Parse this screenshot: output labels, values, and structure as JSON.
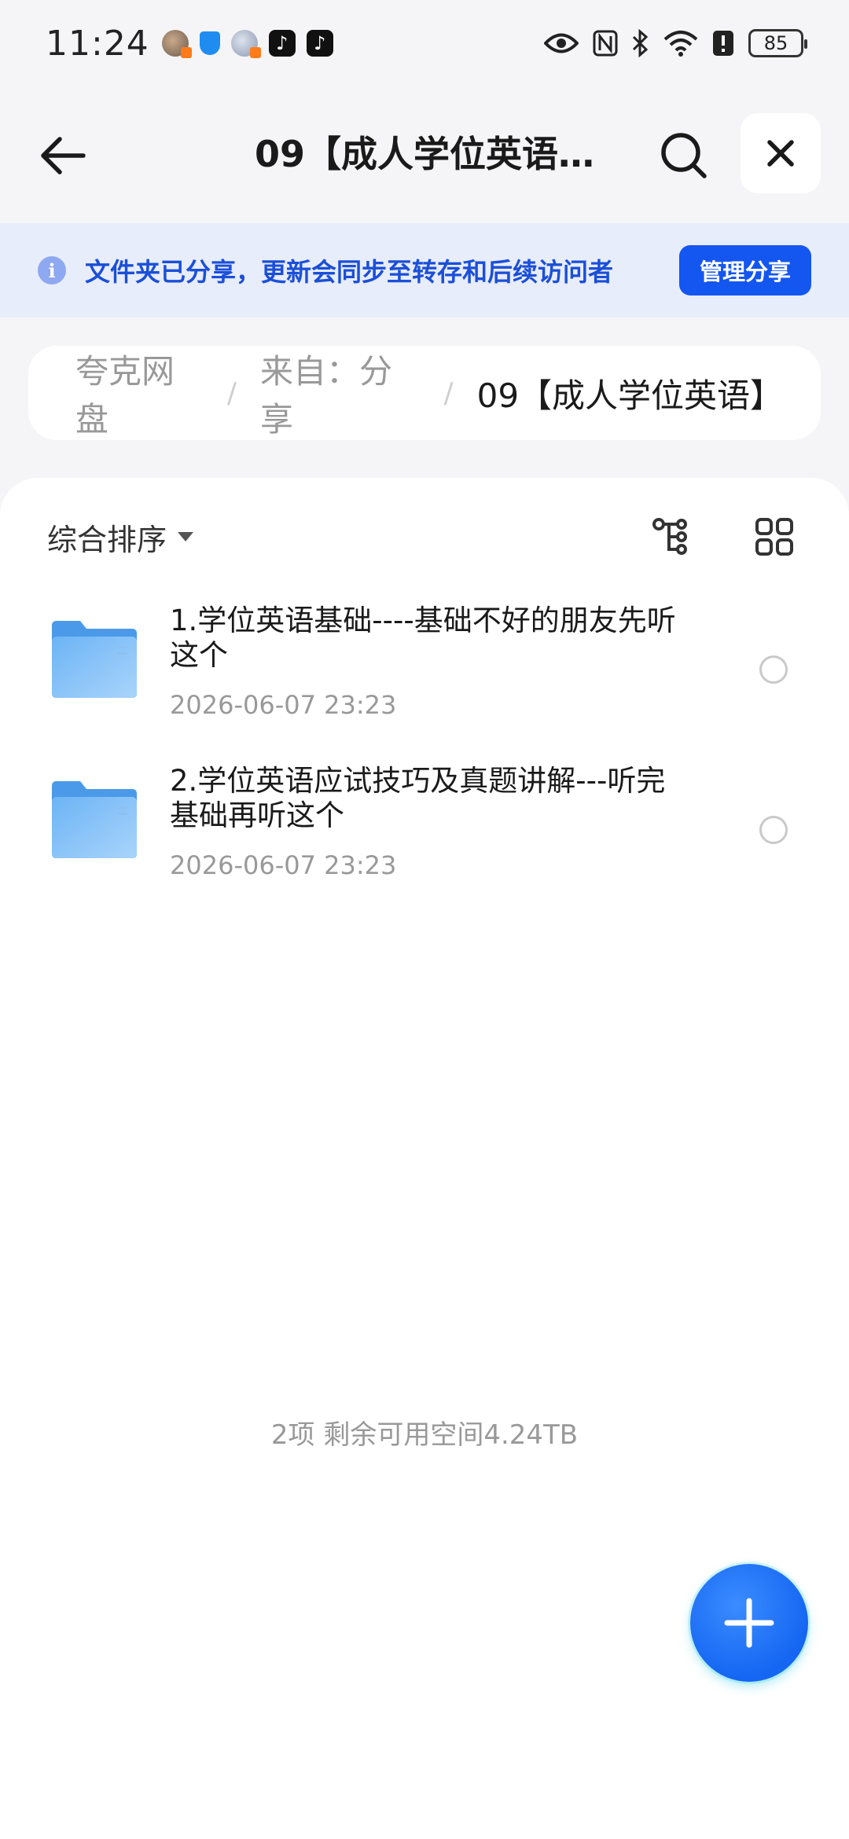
{
  "status_bar": {
    "time": "11:24",
    "battery": "85"
  },
  "header": {
    "title": "09【成人学位英语…"
  },
  "banner": {
    "text": "文件夹已分享，更新会同步至转存和后续访问者",
    "button": "管理分享"
  },
  "breadcrumb": {
    "items": [
      "夸克网盘",
      "来自：分享",
      "09【成人学位英语】"
    ],
    "separator": "/"
  },
  "toolbar": {
    "sort_label": "综合排序"
  },
  "files": [
    {
      "name": "1.学位英语基础----基础不好的朋友先听这个",
      "date": "2026-06-07 23:23"
    },
    {
      "name": "2.学位英语应试技巧及真题讲解---听完基础再听这个",
      "date": "2026-06-07 23:23"
    }
  ],
  "footer": {
    "summary": "2项 剩余可用空间4.24TB"
  },
  "colors": {
    "accent": "#1456f0",
    "banner_bg": "#e8edfb",
    "folder": "#5aa6ee"
  }
}
